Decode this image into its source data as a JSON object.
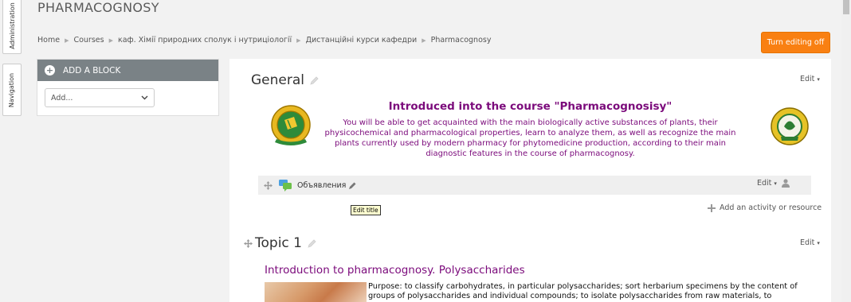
{
  "side_tabs": {
    "administration": "Administration",
    "navigation": "Navigation"
  },
  "header": {
    "title": "PHARMACOGNOSY",
    "breadcrumb": [
      "Home",
      "Courses",
      "каф. Хімії природних сполук і нутриціології",
      "Дистанційні курси кафедри",
      "Pharmacognosy"
    ],
    "edit_mode_button": "Turn editing off"
  },
  "block": {
    "header": "ADD A BLOCK",
    "select_value": "Add..."
  },
  "general": {
    "title": "General",
    "edit_label": "Edit",
    "intro_heading": "Introduced into the course \"Pharmacognosisy\"",
    "intro_text": "You will be able to get acquainted with the main biologically active substances of plants, their physicochemical and pharmacological properties, learn to analyze them, as well as recognize the main plants currently used by modern pharmacy for phytomedicine production, according to their main diagnostic features in the course of pharmacognosy.",
    "activity_name": "Объявления",
    "activity_edit": "Edit",
    "tooltip": "Edit title",
    "add_activity": "Add an activity or resource"
  },
  "topic1": {
    "title": "Topic 1",
    "edit_label": "Edit",
    "heading": "Introduction to pharmacognosy. Polysaccharides",
    "text": "Purpose: to classify carbohydrates, in particular polysaccharides; sort herbarium specimens by the content of groups of polysaccharides and individual compounds; to isolate polysaccharides from raw materials, to"
  },
  "colors": {
    "accent": "#f98012",
    "heading": "#7b0a7b",
    "block_header": "#7a8286"
  }
}
